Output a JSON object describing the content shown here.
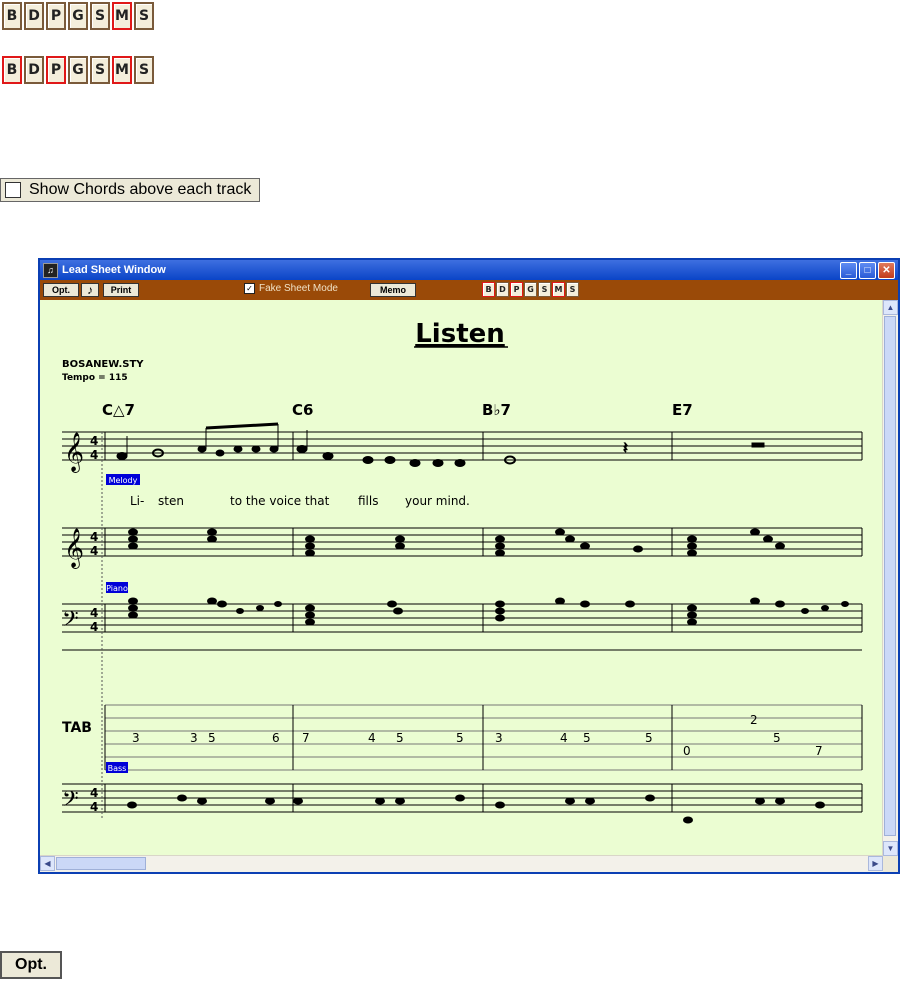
{
  "track_buttons": [
    "B",
    "D",
    "P",
    "G",
    "S",
    "M",
    "S"
  ],
  "show_chords_label": "Show Chords above each track",
  "window": {
    "title": "Lead Sheet Window",
    "opt_label": "Opt.",
    "print_label": "Print",
    "fake_sheet_label": "Fake Sheet Mode",
    "memo_label": "Memo"
  },
  "sheet": {
    "song_title": "Listen",
    "style_file": "BOSANEW.STY",
    "tempo": "Tempo = 115",
    "chords": [
      "C△7",
      "C6",
      "B♭7",
      "E7"
    ],
    "track_labels": {
      "melody": "Melody",
      "piano": "Piano",
      "bass": "Bass"
    },
    "tab_label": "TAB",
    "lyrics": [
      "Li-",
      "sten",
      "to the voice that",
      "fills",
      "your mind."
    ],
    "tab_numbers": [
      "3",
      "3",
      "5",
      "6",
      "7",
      "4",
      "5",
      "5",
      "3",
      "4",
      "5",
      "5",
      "0",
      "2",
      "5",
      "7"
    ]
  },
  "colors": {
    "frame": "#9a4a08",
    "paper": "#ebfdd2",
    "label_bg": "#0000d8",
    "active_track": "#e01818"
  },
  "bottom_opt_label": "Opt."
}
